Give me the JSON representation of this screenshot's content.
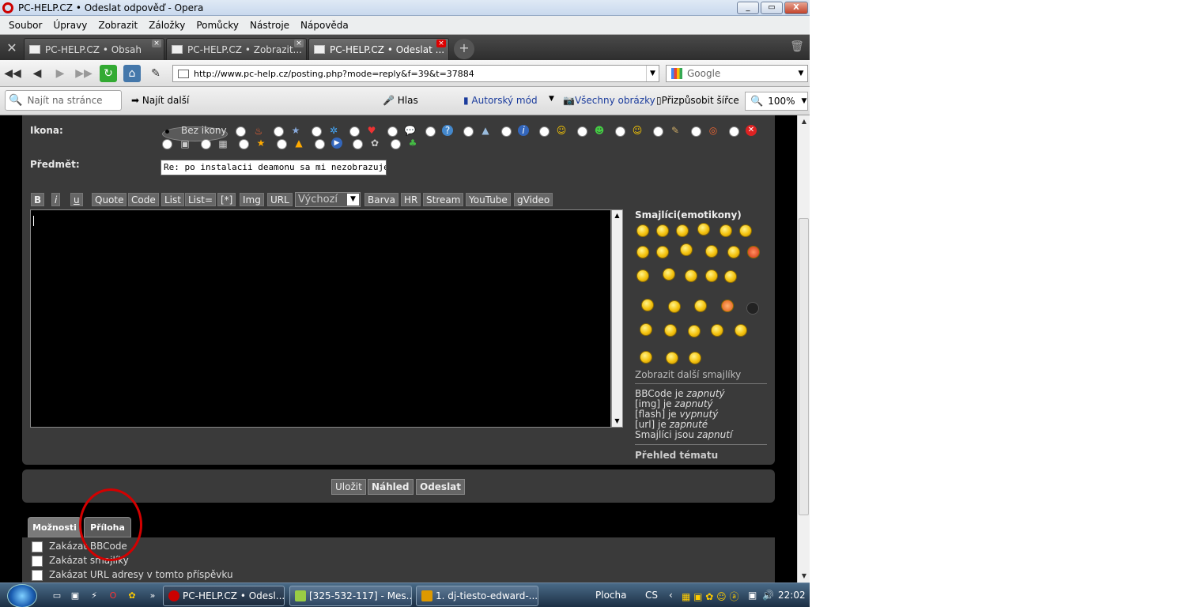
{
  "window": {
    "title": "PC-HELP.CZ • Odeslat odpověď - Opera",
    "controls": [
      "_",
      "▭",
      "X"
    ]
  },
  "menu": [
    "Soubor",
    "Úpravy",
    "Zobrazit",
    "Záložky",
    "Pomůcky",
    "Nástroje",
    "Nápověda"
  ],
  "tabs": [
    {
      "label": "PC-HELP.CZ • Obsah"
    },
    {
      "label": "PC-HELP.CZ • Zobrazit..."
    },
    {
      "label": "PC-HELP.CZ • Odeslat ..."
    }
  ],
  "address": {
    "url": "http://www.pc-help.cz/posting.php?mode=reply&f=39&t=37884"
  },
  "search": {
    "placeholder": "Google"
  },
  "findbar": {
    "placeholder": "Najít na stránce",
    "find_next": "Najít další",
    "voice": "Hlas",
    "author_mode": "Autorský mód",
    "all_images": "Všechny obrázky",
    "fit_width": "Přizpůsobit šířce",
    "zoom": "100%"
  },
  "form": {
    "icon_label": "Ikona:",
    "no_icon": "Bez ikony",
    "subject_label": "Předmět:",
    "subject_value": "Re: po instalacii deamonu sa mi nezobrazuje ikona",
    "bbcode_buttons": [
      "B",
      "i",
      "u",
      "Quote",
      "Code",
      "List",
      "List=",
      "[*]",
      "Img",
      "URL"
    ],
    "font_size": "Výchozí",
    "bbcode_buttons2": [
      "Barva",
      "HR",
      "Stream",
      "YouTube",
      "gVideo"
    ]
  },
  "sidebar": {
    "smilies_title": "Smajlíci(emotikony)",
    "more_smilies": "Zobrazit další smajlíky",
    "status": {
      "bbcode": "BBCode",
      "bbcode_is": " je ",
      "bbcode_state": "zapnutý",
      "img": "[img] je ",
      "img_state": "zapnutý",
      "flash": "[flash] je ",
      "flash_state": "vypnutý",
      "url": "[url] je ",
      "url_state": "zapnuté",
      "smilies": "Smajlíci jsou ",
      "smilies_state": "zapnutí"
    },
    "topic_review": "Přehled tématu"
  },
  "actions": {
    "save": "Uložit",
    "preview": "Náhled",
    "submit": "Odeslat"
  },
  "lower_tabs": {
    "options": "Možnosti",
    "attachment": "Příloha"
  },
  "options": [
    "Zakázat BBCode",
    "Zakázat smajlíky",
    "Zakázat URL adresy v tomto příspěvku"
  ],
  "taskbar": {
    "items": [
      "PC-HELP.CZ • Odesl...",
      "[325-532-117] - Mes...",
      "1. dj-tiesto-edward-..."
    ],
    "desktop": "Plocha",
    "lang": "CS",
    "time": "22:02"
  },
  "colors": {
    "highlight_circle": "#d30000",
    "panel": "#3a3a3a",
    "page_bg": "#000000"
  }
}
